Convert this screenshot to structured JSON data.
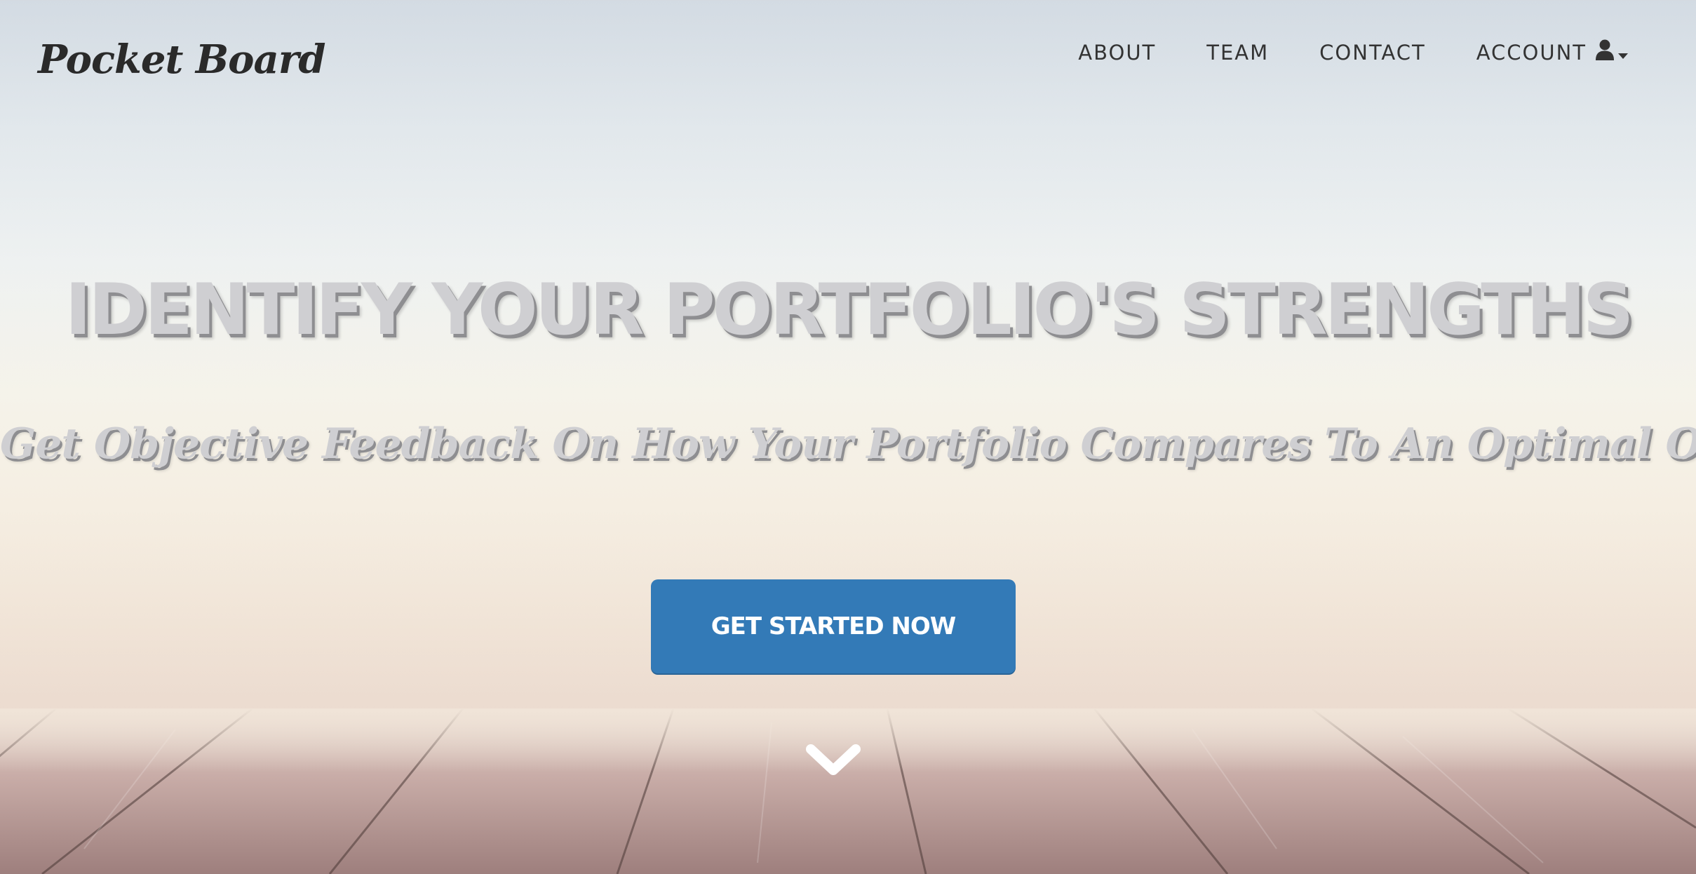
{
  "header": {
    "logo": "Pocket Board",
    "nav": [
      {
        "label": "ABOUT"
      },
      {
        "label": "TEAM"
      },
      {
        "label": "CONTACT"
      },
      {
        "label": "ACCOUNT",
        "icon": "user-icon",
        "has_dropdown": true
      }
    ]
  },
  "hero": {
    "title": "IDENTIFY YOUR PORTFOLIO'S STRENGTHS",
    "subtitle": "Get Objective Feedback On How Your Portfolio Compares To An Optimal One",
    "cta_label": "GET STARTED NOW",
    "scroll_icon": "chevron-down-icon"
  },
  "colors": {
    "accent": "#337ab7",
    "nav_text": "#333333",
    "hero_text": "#cfcfd2"
  }
}
